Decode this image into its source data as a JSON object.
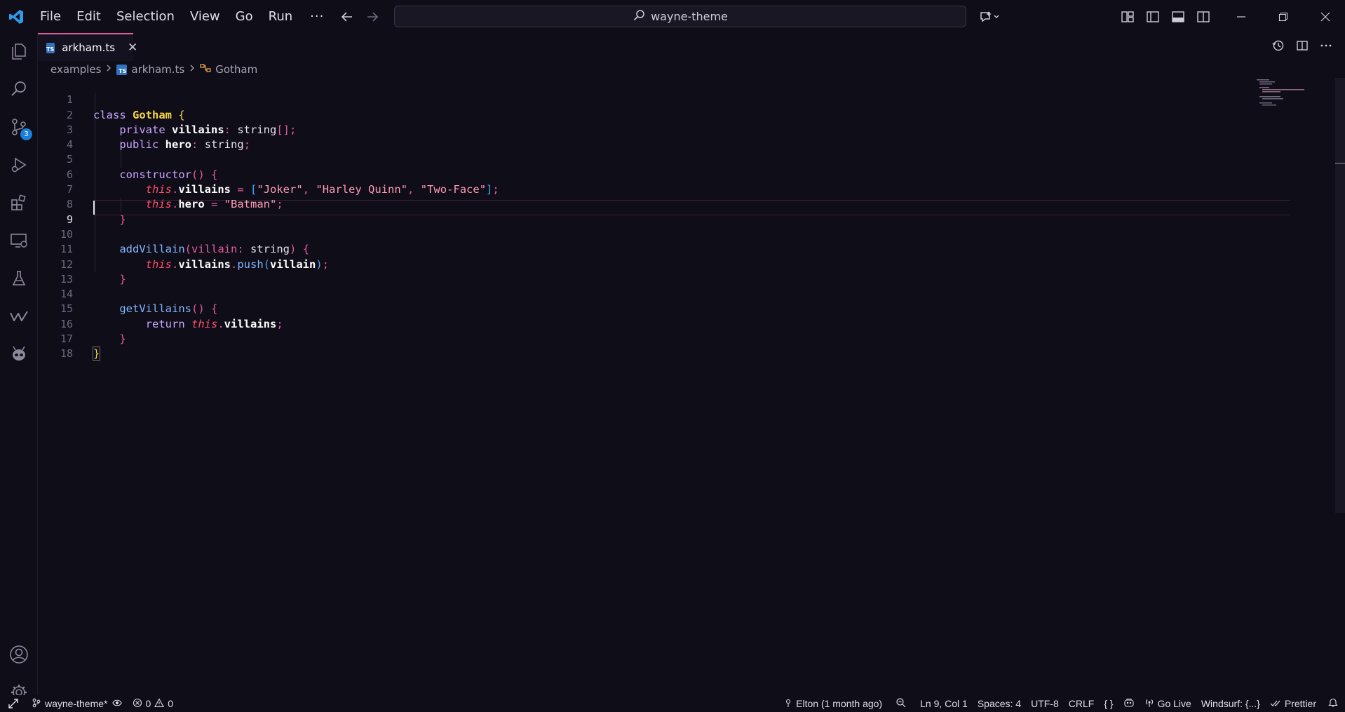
{
  "menu": [
    "File",
    "Edit",
    "Selection",
    "View",
    "Go",
    "Run"
  ],
  "menu_more": "···",
  "search": {
    "text": "wayne-theme"
  },
  "activity": {
    "source_control_badge": "3"
  },
  "tab": {
    "label": "arkham.ts",
    "icon_text": "TS",
    "close": "✕"
  },
  "breadcrumb": {
    "folder": "examples",
    "file": "arkham.ts",
    "symbol": "Gotham"
  },
  "editor": {
    "line_numbers": [
      "1",
      "2",
      "3",
      "4",
      "5",
      "6",
      "7",
      "8",
      "9",
      "10",
      "11",
      "12",
      "13",
      "14",
      "15",
      "16",
      "17",
      "18"
    ],
    "active_line": "9"
  },
  "status": {
    "branch": "wayne-theme*",
    "errors": "0",
    "warnings": "0",
    "blame": "Elton (1 month ago)",
    "position": "Ln 9, Col 1",
    "spaces": "Spaces: 4",
    "encoding": "UTF-8",
    "eol": "CRLF",
    "language": "{ }",
    "go_live": "Go Live",
    "windsurf": "Windsurf: {...}",
    "prettier": "Prettier"
  },
  "colors": {
    "background": "#0f0d17",
    "accent": "#e05d9f",
    "keyword": "#c9a3ff",
    "class_name": "#f5d547",
    "this": "#ff4d6d",
    "string": "#ff9bb5",
    "function": "#82b6ff",
    "badge": "#1a80d9"
  }
}
